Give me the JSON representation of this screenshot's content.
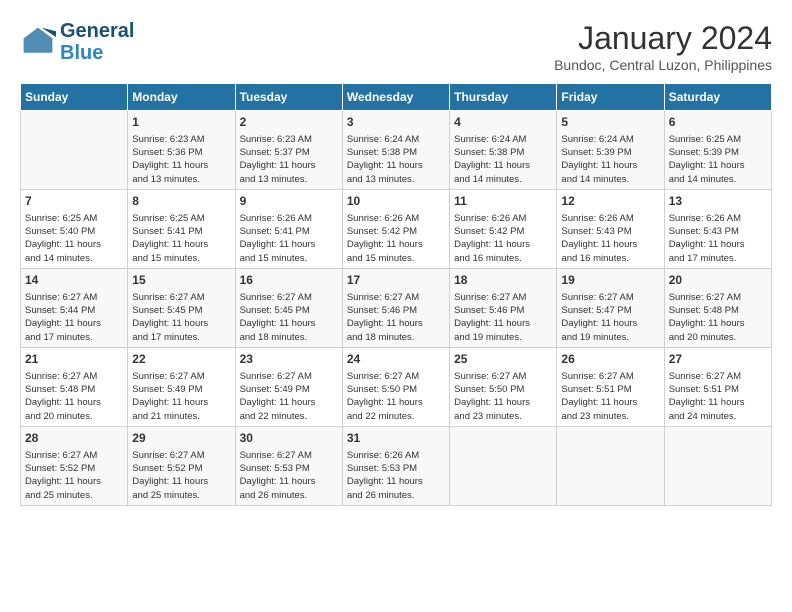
{
  "header": {
    "logo_line1": "General",
    "logo_line2": "Blue",
    "month": "January 2024",
    "location": "Bundoc, Central Luzon, Philippines"
  },
  "weekdays": [
    "Sunday",
    "Monday",
    "Tuesday",
    "Wednesday",
    "Thursday",
    "Friday",
    "Saturday"
  ],
  "weeks": [
    [
      {
        "day": "",
        "info": ""
      },
      {
        "day": "1",
        "info": "Sunrise: 6:23 AM\nSunset: 5:36 PM\nDaylight: 11 hours\nand 13 minutes."
      },
      {
        "day": "2",
        "info": "Sunrise: 6:23 AM\nSunset: 5:37 PM\nDaylight: 11 hours\nand 13 minutes."
      },
      {
        "day": "3",
        "info": "Sunrise: 6:24 AM\nSunset: 5:38 PM\nDaylight: 11 hours\nand 13 minutes."
      },
      {
        "day": "4",
        "info": "Sunrise: 6:24 AM\nSunset: 5:38 PM\nDaylight: 11 hours\nand 14 minutes."
      },
      {
        "day": "5",
        "info": "Sunrise: 6:24 AM\nSunset: 5:39 PM\nDaylight: 11 hours\nand 14 minutes."
      },
      {
        "day": "6",
        "info": "Sunrise: 6:25 AM\nSunset: 5:39 PM\nDaylight: 11 hours\nand 14 minutes."
      }
    ],
    [
      {
        "day": "7",
        "info": "Sunrise: 6:25 AM\nSunset: 5:40 PM\nDaylight: 11 hours\nand 14 minutes."
      },
      {
        "day": "8",
        "info": "Sunrise: 6:25 AM\nSunset: 5:41 PM\nDaylight: 11 hours\nand 15 minutes."
      },
      {
        "day": "9",
        "info": "Sunrise: 6:26 AM\nSunset: 5:41 PM\nDaylight: 11 hours\nand 15 minutes."
      },
      {
        "day": "10",
        "info": "Sunrise: 6:26 AM\nSunset: 5:42 PM\nDaylight: 11 hours\nand 15 minutes."
      },
      {
        "day": "11",
        "info": "Sunrise: 6:26 AM\nSunset: 5:42 PM\nDaylight: 11 hours\nand 16 minutes."
      },
      {
        "day": "12",
        "info": "Sunrise: 6:26 AM\nSunset: 5:43 PM\nDaylight: 11 hours\nand 16 minutes."
      },
      {
        "day": "13",
        "info": "Sunrise: 6:26 AM\nSunset: 5:43 PM\nDaylight: 11 hours\nand 17 minutes."
      }
    ],
    [
      {
        "day": "14",
        "info": "Sunrise: 6:27 AM\nSunset: 5:44 PM\nDaylight: 11 hours\nand 17 minutes."
      },
      {
        "day": "15",
        "info": "Sunrise: 6:27 AM\nSunset: 5:45 PM\nDaylight: 11 hours\nand 17 minutes."
      },
      {
        "day": "16",
        "info": "Sunrise: 6:27 AM\nSunset: 5:45 PM\nDaylight: 11 hours\nand 18 minutes."
      },
      {
        "day": "17",
        "info": "Sunrise: 6:27 AM\nSunset: 5:46 PM\nDaylight: 11 hours\nand 18 minutes."
      },
      {
        "day": "18",
        "info": "Sunrise: 6:27 AM\nSunset: 5:46 PM\nDaylight: 11 hours\nand 19 minutes."
      },
      {
        "day": "19",
        "info": "Sunrise: 6:27 AM\nSunset: 5:47 PM\nDaylight: 11 hours\nand 19 minutes."
      },
      {
        "day": "20",
        "info": "Sunrise: 6:27 AM\nSunset: 5:48 PM\nDaylight: 11 hours\nand 20 minutes."
      }
    ],
    [
      {
        "day": "21",
        "info": "Sunrise: 6:27 AM\nSunset: 5:48 PM\nDaylight: 11 hours\nand 20 minutes."
      },
      {
        "day": "22",
        "info": "Sunrise: 6:27 AM\nSunset: 5:49 PM\nDaylight: 11 hours\nand 21 minutes."
      },
      {
        "day": "23",
        "info": "Sunrise: 6:27 AM\nSunset: 5:49 PM\nDaylight: 11 hours\nand 22 minutes."
      },
      {
        "day": "24",
        "info": "Sunrise: 6:27 AM\nSunset: 5:50 PM\nDaylight: 11 hours\nand 22 minutes."
      },
      {
        "day": "25",
        "info": "Sunrise: 6:27 AM\nSunset: 5:50 PM\nDaylight: 11 hours\nand 23 minutes."
      },
      {
        "day": "26",
        "info": "Sunrise: 6:27 AM\nSunset: 5:51 PM\nDaylight: 11 hours\nand 23 minutes."
      },
      {
        "day": "27",
        "info": "Sunrise: 6:27 AM\nSunset: 5:51 PM\nDaylight: 11 hours\nand 24 minutes."
      }
    ],
    [
      {
        "day": "28",
        "info": "Sunrise: 6:27 AM\nSunset: 5:52 PM\nDaylight: 11 hours\nand 25 minutes."
      },
      {
        "day": "29",
        "info": "Sunrise: 6:27 AM\nSunset: 5:52 PM\nDaylight: 11 hours\nand 25 minutes."
      },
      {
        "day": "30",
        "info": "Sunrise: 6:27 AM\nSunset: 5:53 PM\nDaylight: 11 hours\nand 26 minutes."
      },
      {
        "day": "31",
        "info": "Sunrise: 6:26 AM\nSunset: 5:53 PM\nDaylight: 11 hours\nand 26 minutes."
      },
      {
        "day": "",
        "info": ""
      },
      {
        "day": "",
        "info": ""
      },
      {
        "day": "",
        "info": ""
      }
    ]
  ]
}
